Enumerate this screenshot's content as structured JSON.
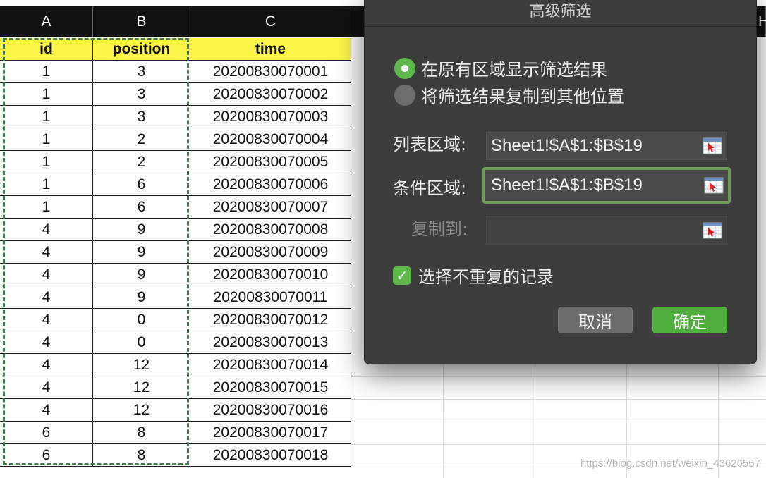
{
  "sheet": {
    "column_headers": [
      "A",
      "B",
      "C"
    ],
    "next_column_hint": "H",
    "table_headers": [
      "id",
      "position",
      "time"
    ],
    "rows": [
      [
        "1",
        "3",
        "20200830070001"
      ],
      [
        "1",
        "3",
        "20200830070002"
      ],
      [
        "1",
        "3",
        "20200830070003"
      ],
      [
        "1",
        "2",
        "20200830070004"
      ],
      [
        "1",
        "2",
        "20200830070005"
      ],
      [
        "1",
        "6",
        "20200830070006"
      ],
      [
        "1",
        "6",
        "20200830070007"
      ],
      [
        "4",
        "9",
        "20200830070008"
      ],
      [
        "4",
        "9",
        "20200830070009"
      ],
      [
        "4",
        "9",
        "20200830070010"
      ],
      [
        "4",
        "9",
        "20200830070011"
      ],
      [
        "4",
        "0",
        "20200830070012"
      ],
      [
        "4",
        "0",
        "20200830070013"
      ],
      [
        "4",
        "12",
        "20200830070014"
      ],
      [
        "4",
        "12",
        "20200830070015"
      ],
      [
        "4",
        "12",
        "20200830070016"
      ],
      [
        "6",
        "8",
        "20200830070017"
      ],
      [
        "6",
        "8",
        "20200830070018"
      ]
    ],
    "header_fill_color": "#fdf44a",
    "selection_marquee_color": "#3f7a4d"
  },
  "dialog": {
    "title": "高级筛选",
    "radio_in_place": "在原有区域显示筛选结果",
    "radio_copy": "将筛选结果复制到其他位置",
    "radio_selected": "in_place",
    "list_range_label": "列表区域:",
    "list_range_value": "Sheet1!$A$1:$B$19",
    "criteria_range_label": "条件区域:",
    "criteria_range_value": "Sheet1!$A$1:$B$19",
    "copy_to_label": "复制到:",
    "copy_to_value": "",
    "unique_records_label": "选择不重复的记录",
    "unique_records_checked": true,
    "cancel_label": "取消",
    "ok_label": "确定",
    "accent_color": "#5fb84a"
  },
  "watermark": "https://blog.csdn.net/weixin_43626557"
}
